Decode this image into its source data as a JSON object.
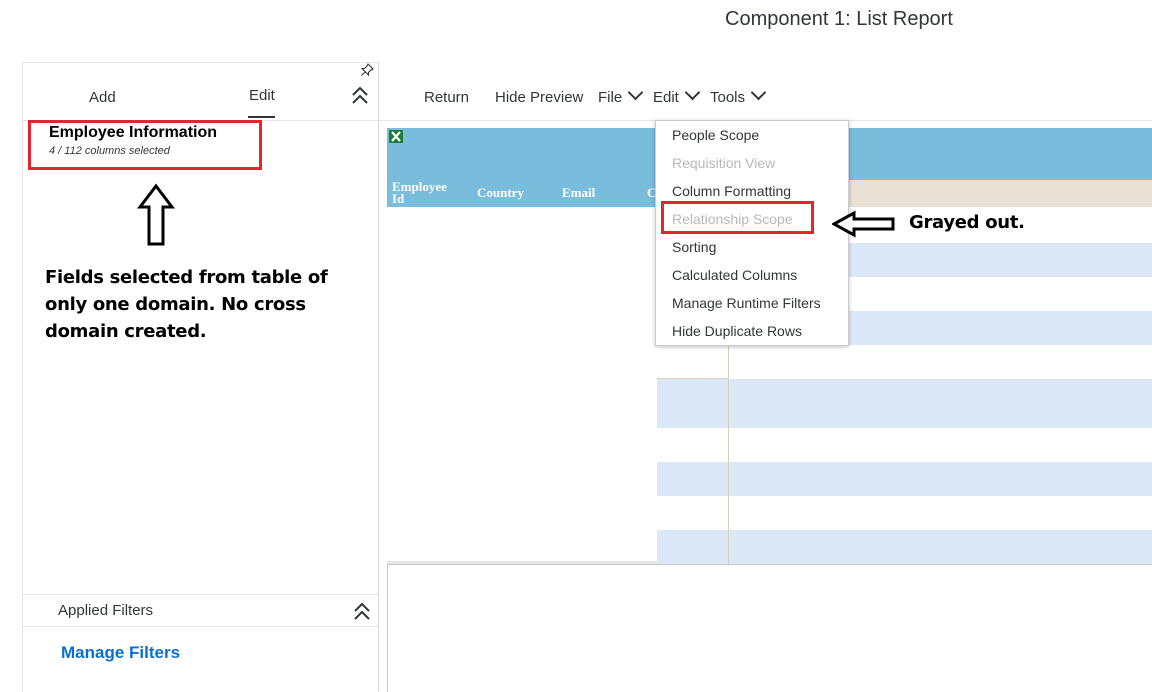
{
  "header": {
    "title": "Component 1: List Report"
  },
  "left_panel": {
    "tabs": [
      {
        "label": "Add"
      },
      {
        "label": "Edit"
      }
    ],
    "domain": {
      "title": "Employee Information",
      "subtitle": "4 / 112 columns selected"
    },
    "filters": {
      "applied_label": "Applied Filters",
      "manage_label": "Manage Filters"
    }
  },
  "toolbar": {
    "return_label": "Return",
    "hide_preview_label": "Hide Preview",
    "file_label": "File",
    "edit_label": "Edit",
    "tools_label": "Tools"
  },
  "preview": {
    "columns": [
      "Employee Id",
      "Country",
      "Email",
      "C"
    ]
  },
  "edit_menu": {
    "items": [
      {
        "label": "People Scope",
        "disabled": false
      },
      {
        "label": "Requisition View",
        "disabled": true
      },
      {
        "label": "Column Formatting",
        "disabled": false
      },
      {
        "label": "Relationship Scope",
        "disabled": true
      },
      {
        "label": "Sorting",
        "disabled": false
      },
      {
        "label": "Calculated Columns",
        "disabled": false
      },
      {
        "label": "Manage Runtime Filters",
        "disabled": false
      },
      {
        "label": "Hide Duplicate Rows",
        "disabled": false
      }
    ]
  },
  "annotations": {
    "fields_note": "Fields selected from table of only one domain. No cross domain created.",
    "grayed_note": "Grayed out."
  },
  "colors": {
    "highlight_red": "#e3262e",
    "header_blue": "#79bcdc",
    "stripe_blue": "#dbe8f7",
    "link_blue": "#0a6ed1"
  }
}
